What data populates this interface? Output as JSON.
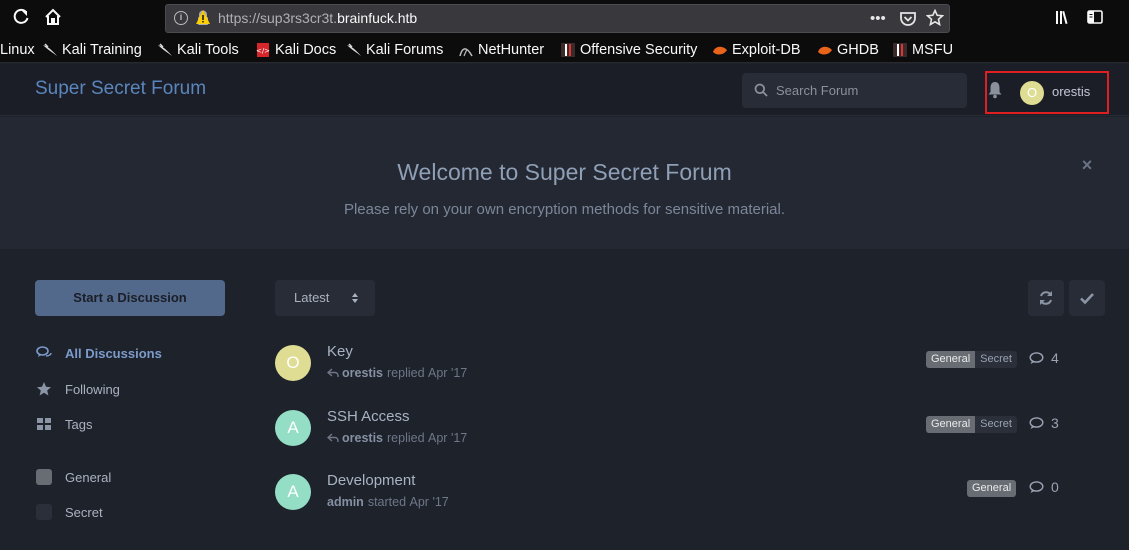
{
  "browser": {
    "url_prefix": "https://sup3rs3cr3t.",
    "url_domain": "brainfuck.htb",
    "bookmarks": [
      {
        "label": "Linux",
        "icon": "kali-icon"
      },
      {
        "label": "Kali Training",
        "icon": "kali-dragon-icon"
      },
      {
        "label": "Kali Tools",
        "icon": "kali-dragon-icon"
      },
      {
        "label": "Kali Docs",
        "icon": "docs-icon"
      },
      {
        "label": "Kali Forums",
        "icon": "kali-dragon-icon"
      },
      {
        "label": "NetHunter",
        "icon": "nethunter-icon"
      },
      {
        "label": "Offensive Security",
        "icon": "offsec-icon"
      },
      {
        "label": "Exploit-DB",
        "icon": "exploitdb-icon"
      },
      {
        "label": "GHDB",
        "icon": "exploitdb-icon"
      },
      {
        "label": "MSFU",
        "icon": "offsec-icon"
      }
    ]
  },
  "header": {
    "brand": "Super Secret Forum",
    "search_placeholder": "Search Forum",
    "user": {
      "initial": "O",
      "name": "orestis",
      "avatar_color": "#dedd93"
    }
  },
  "hero": {
    "title": "Welcome to Super Secret Forum",
    "subtitle": "Please rely on your own encryption methods for sensitive material."
  },
  "sidebar": {
    "start_label": "Start a Discussion",
    "nav": [
      {
        "label": "All Discussions",
        "icon": "chat-bubbles-icon",
        "active": true
      },
      {
        "label": "Following",
        "icon": "star-icon",
        "active": false
      },
      {
        "label": "Tags",
        "icon": "grid-icon",
        "active": false
      }
    ],
    "tags": [
      {
        "label": "General",
        "color": "#686d74"
      },
      {
        "label": "Secret",
        "color": "#2a2f39"
      }
    ]
  },
  "toolbar": {
    "sort_label": "Latest"
  },
  "discussions": [
    {
      "title": "Key",
      "initial": "O",
      "avatar_color": "#dedd93",
      "author": "orestis",
      "action": "replied",
      "date": "Apr '17",
      "tags": [
        "General",
        "Secret"
      ],
      "replies": "4"
    },
    {
      "title": "SSH Access",
      "initial": "A",
      "avatar_color": "#93dec5",
      "author": "orestis",
      "action": "replied",
      "date": "Apr '17",
      "tags": [
        "General",
        "Secret"
      ],
      "replies": "3"
    },
    {
      "title": "Development",
      "initial": "A",
      "avatar_color": "#93dec5",
      "author": "admin",
      "action": "started",
      "date": "Apr '17",
      "tags": [
        "General"
      ],
      "replies": "0"
    }
  ]
}
